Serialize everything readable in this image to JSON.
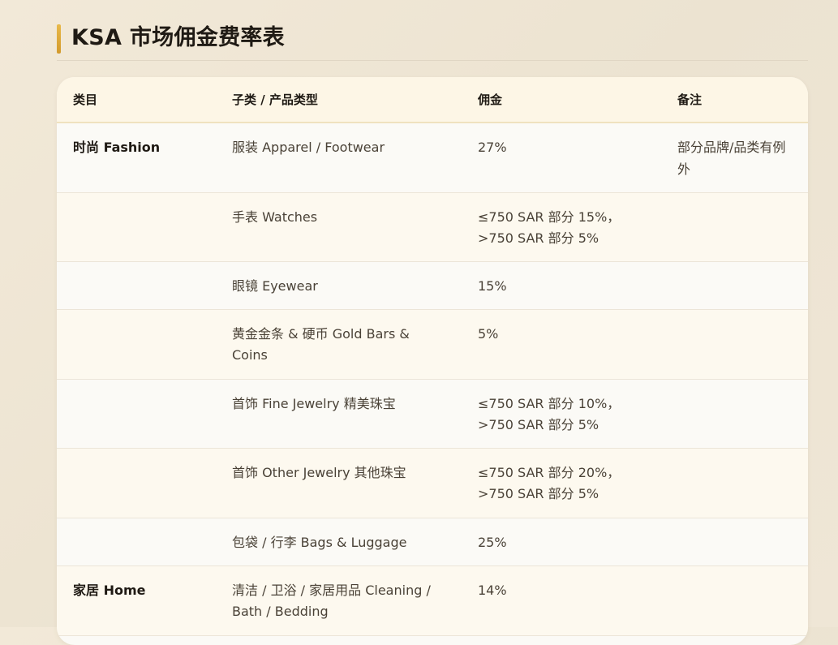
{
  "page": {
    "title": "KSA 市场佣金费率表"
  },
  "table": {
    "headers": [
      "类目",
      "子类 / 产品类型",
      "佣金",
      "备注"
    ],
    "rows": [
      {
        "category": "时尚 Fashion",
        "subcategory": "服装 Apparel / Footwear",
        "commission": "27%",
        "note": "部分品牌/品类有例外"
      },
      {
        "category": "",
        "subcategory": "手表 Watches",
        "commission": "≤750 SAR 部分 15%，>750 SAR 部分 5%",
        "note": ""
      },
      {
        "category": "",
        "subcategory": "眼镜 Eyewear",
        "commission": "15%",
        "note": ""
      },
      {
        "category": "",
        "subcategory": "黄金金条 & 硬币 Gold Bars & Coins",
        "commission": "5%",
        "note": ""
      },
      {
        "category": "",
        "subcategory": "首饰 Fine Jewelry 精美珠宝",
        "commission": "≤750 SAR 部分 10%，>750 SAR 部分 5%",
        "note": ""
      },
      {
        "category": "",
        "subcategory": "首饰 Other Jewelry 其他珠宝",
        "commission": "≤750 SAR 部分 20%，>750 SAR 部分 5%",
        "note": ""
      },
      {
        "category": "",
        "subcategory": "包袋 / 行李 Bags & Luggage",
        "commission": "25%",
        "note": ""
      },
      {
        "category": "家居 Home",
        "subcategory": "清洁 / 卫浴 / 家居用品 Cleaning / Bath / Bedding",
        "commission": "14%",
        "note": ""
      }
    ]
  }
}
